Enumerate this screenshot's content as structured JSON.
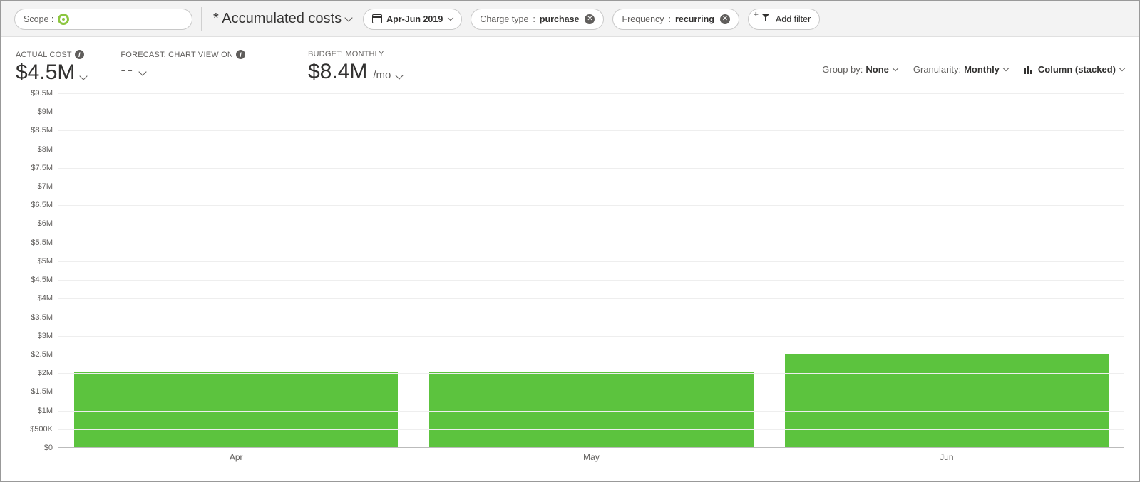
{
  "toolbar": {
    "scope_label": "Scope :",
    "view_title": "* Accumulated costs",
    "date_range": "Apr-Jun 2019",
    "filters": [
      {
        "key": "Charge type",
        "value": "purchase"
      },
      {
        "key": "Frequency",
        "value": "recurring"
      }
    ],
    "add_filter_label": "Add filter"
  },
  "kpis": {
    "actual": {
      "label": "ACTUAL COST",
      "value": "$4.5M"
    },
    "forecast": {
      "label": "FORECAST: CHART VIEW ON",
      "value": "--"
    },
    "budget": {
      "label": "BUDGET: MONTHLY",
      "value": "$8.4M",
      "suffix": "/mo"
    }
  },
  "controls": {
    "groupby_label": "Group by:",
    "groupby_value": "None",
    "granularity_label": "Granularity:",
    "granularity_value": "Monthly",
    "charttype_value": "Column (stacked)"
  },
  "chart_data": {
    "type": "bar",
    "categories": [
      "Apr",
      "May",
      "Jun"
    ],
    "values": [
      2000000,
      2000000,
      2500000
    ],
    "xlabel": "",
    "ylabel": "",
    "ylim": [
      0,
      9500000
    ],
    "yticks": [
      0,
      500000,
      1000000,
      1500000,
      2000000,
      2500000,
      3000000,
      3500000,
      4000000,
      4500000,
      5000000,
      5500000,
      6000000,
      6500000,
      7000000,
      7500000,
      8000000,
      8500000,
      9000000,
      9500000
    ],
    "ytick_labels": [
      "$0",
      "$500K",
      "$1M",
      "$1.5M",
      "$2M",
      "$2.5M",
      "$3M",
      "$3.5M",
      "$4M",
      "$4.5M",
      "$5M",
      "$5.5M",
      "$6M",
      "$6.5M",
      "$7M",
      "$7.5M",
      "$8M",
      "$8.5M",
      "$9M",
      "$9.5M"
    ],
    "bar_color": "#5cc33e"
  }
}
